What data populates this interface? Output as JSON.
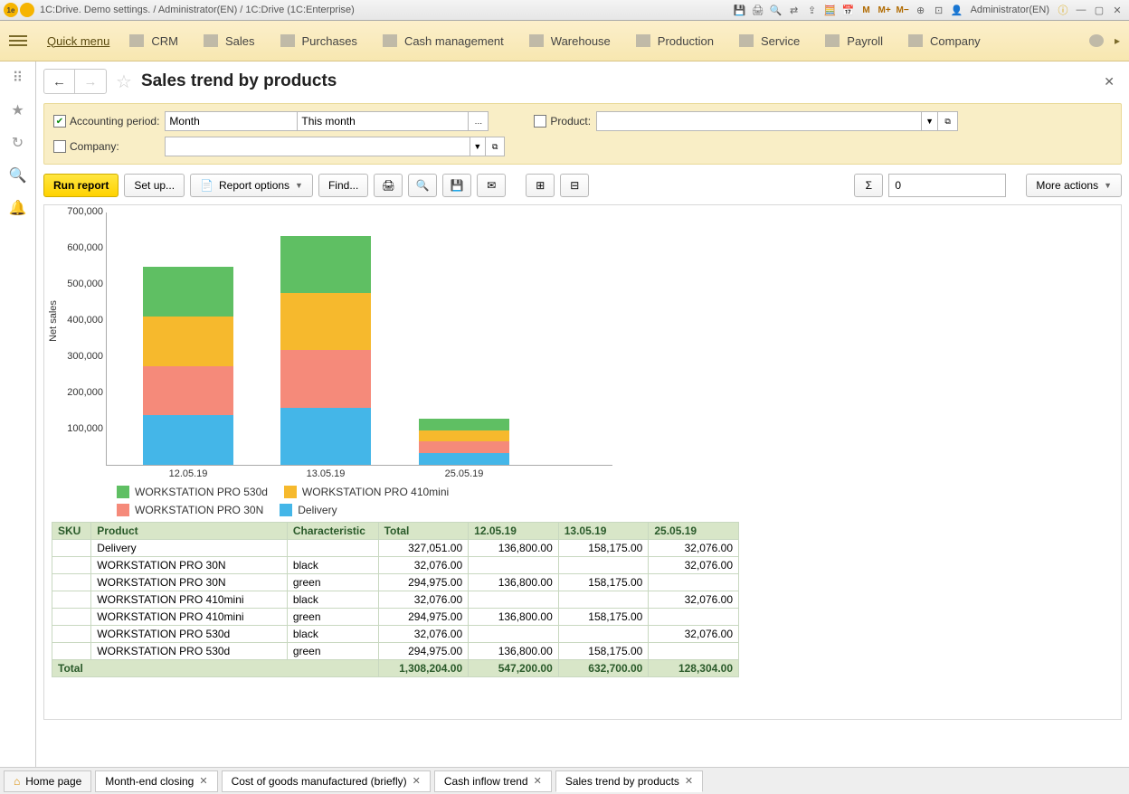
{
  "titlebar": {
    "title": "1C:Drive. Demo settings. / Administrator(EN) / 1C:Drive  (1C:Enterprise)",
    "user": "Administrator(EN)"
  },
  "mainmenu": {
    "quick": "Quick menu",
    "items": [
      "CRM",
      "Sales",
      "Purchases",
      "Cash management",
      "Warehouse",
      "Production",
      "Service",
      "Payroll",
      "Company"
    ]
  },
  "page": {
    "title": "Sales trend by products"
  },
  "filters": {
    "accounting_label": "Accounting period:",
    "company_label": "Company:",
    "product_label": "Product:",
    "month_value": "Month",
    "range_value": "This month"
  },
  "toolbar": {
    "run": "Run report",
    "setup": "Set up...",
    "options": "Report options",
    "find": "Find...",
    "sigma_value": "0",
    "more": "More actions"
  },
  "chart_data": {
    "type": "bar",
    "ylabel": "Net sales",
    "ylim": [
      0,
      700000
    ],
    "y_ticks": [
      "100,000",
      "200,000",
      "300,000",
      "400,000",
      "500,000",
      "600,000",
      "700,000"
    ],
    "categories": [
      "12.05.19",
      "13.05.19",
      "25.05.19"
    ],
    "series": [
      {
        "name": "WORKSTATION PRO 530d",
        "color": "green",
        "values": [
          136800,
          158175,
          32076
        ]
      },
      {
        "name": "WORKSTATION PRO 410mini",
        "color": "orange",
        "values": [
          136800,
          158175,
          32076
        ]
      },
      {
        "name": "WORKSTATION PRO 30N",
        "color": "red",
        "values": [
          136800,
          158175,
          32076
        ]
      },
      {
        "name": "Delivery",
        "color": "blue",
        "values": [
          136800,
          158175,
          32076
        ]
      }
    ],
    "legend": [
      "WORKSTATION PRO 530d",
      "WORKSTATION PRO 410mini",
      "WORKSTATION PRO 30N",
      "Delivery"
    ]
  },
  "table": {
    "headers": [
      "SKU",
      "Product",
      "Characteristic",
      "Total",
      "12.05.19",
      "13.05.19",
      "25.05.19"
    ],
    "rows": [
      {
        "sku": "",
        "product": "Delivery",
        "char": "",
        "total": "327,051.00",
        "d1": "136,800.00",
        "d2": "158,175.00",
        "d3": "32,076.00"
      },
      {
        "sku": "",
        "product": "WORKSTATION PRO 30N",
        "char": "black",
        "total": "32,076.00",
        "d1": "",
        "d2": "",
        "d3": "32,076.00"
      },
      {
        "sku": "",
        "product": "WORKSTATION PRO 30N",
        "char": "green",
        "total": "294,975.00",
        "d1": "136,800.00",
        "d2": "158,175.00",
        "d3": ""
      },
      {
        "sku": "",
        "product": "WORKSTATION PRO 410mini",
        "char": "black",
        "total": "32,076.00",
        "d1": "",
        "d2": "",
        "d3": "32,076.00"
      },
      {
        "sku": "",
        "product": "WORKSTATION PRO 410mini",
        "char": "green",
        "total": "294,975.00",
        "d1": "136,800.00",
        "d2": "158,175.00",
        "d3": ""
      },
      {
        "sku": "",
        "product": "WORKSTATION PRO 530d",
        "char": "black",
        "total": "32,076.00",
        "d1": "",
        "d2": "",
        "d3": "32,076.00"
      },
      {
        "sku": "",
        "product": "WORKSTATION PRO 530d",
        "char": "green",
        "total": "294,975.00",
        "d1": "136,800.00",
        "d2": "158,175.00",
        "d3": ""
      }
    ],
    "total_label": "Total",
    "totals": {
      "total": "1,308,204.00",
      "d1": "547,200.00",
      "d2": "632,700.00",
      "d3": "128,304.00"
    }
  },
  "tabs": {
    "home": "Home page",
    "items": [
      "Month-end closing",
      "Cost of goods manufactured (briefly)",
      "Cash inflow trend",
      "Sales trend by products"
    ],
    "active_index": 3
  }
}
